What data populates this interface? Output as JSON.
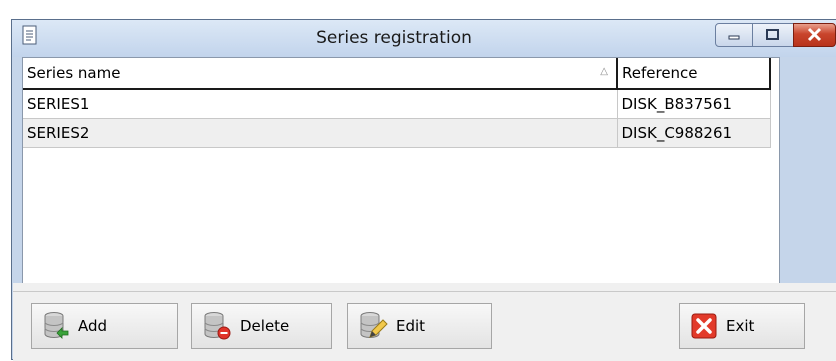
{
  "window": {
    "title": "Series registration"
  },
  "grid": {
    "columns": [
      "Series name",
      "Reference"
    ],
    "sort_indicator": "△",
    "rows": [
      {
        "name": "SERIES1",
        "reference": "DISK_B837561"
      },
      {
        "name": "SERIES2",
        "reference": "DISK_C988261"
      }
    ]
  },
  "toolbar": {
    "add_label": "Add",
    "delete_label": "Delete",
    "edit_label": "Edit",
    "exit_label": "Exit"
  },
  "colors": {
    "window_frame": "#c5d5ea",
    "close_button": "#c9452c",
    "selection_alt_row": "#efefef"
  }
}
